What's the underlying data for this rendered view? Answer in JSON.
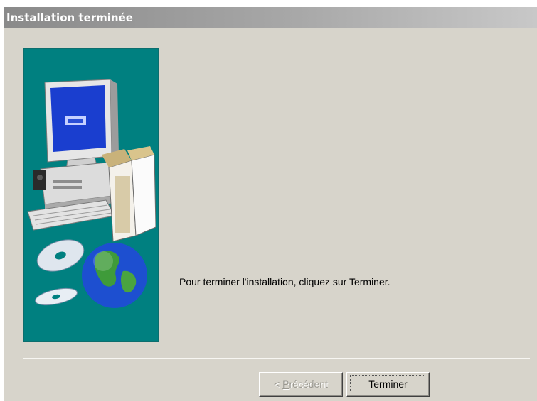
{
  "window": {
    "title": "Installation terminée"
  },
  "content": {
    "message": "Pour terminer l'installation, cliquez sur Terminer."
  },
  "buttons": {
    "previous": {
      "prefix": "< ",
      "accel": "P",
      "rest": "récédent",
      "enabled": false
    },
    "finish": {
      "label": "Terminer",
      "enabled": true
    }
  },
  "colors": {
    "dialog_bg": "#d7d4cb",
    "side_panel": "#008080",
    "title_gradient_start": "#8a8a8a",
    "title_gradient_end": "#c8c8c8"
  },
  "icons": [
    "computer-illustration",
    "cd-disc-icon",
    "globe-icon",
    "software-box-icon"
  ]
}
